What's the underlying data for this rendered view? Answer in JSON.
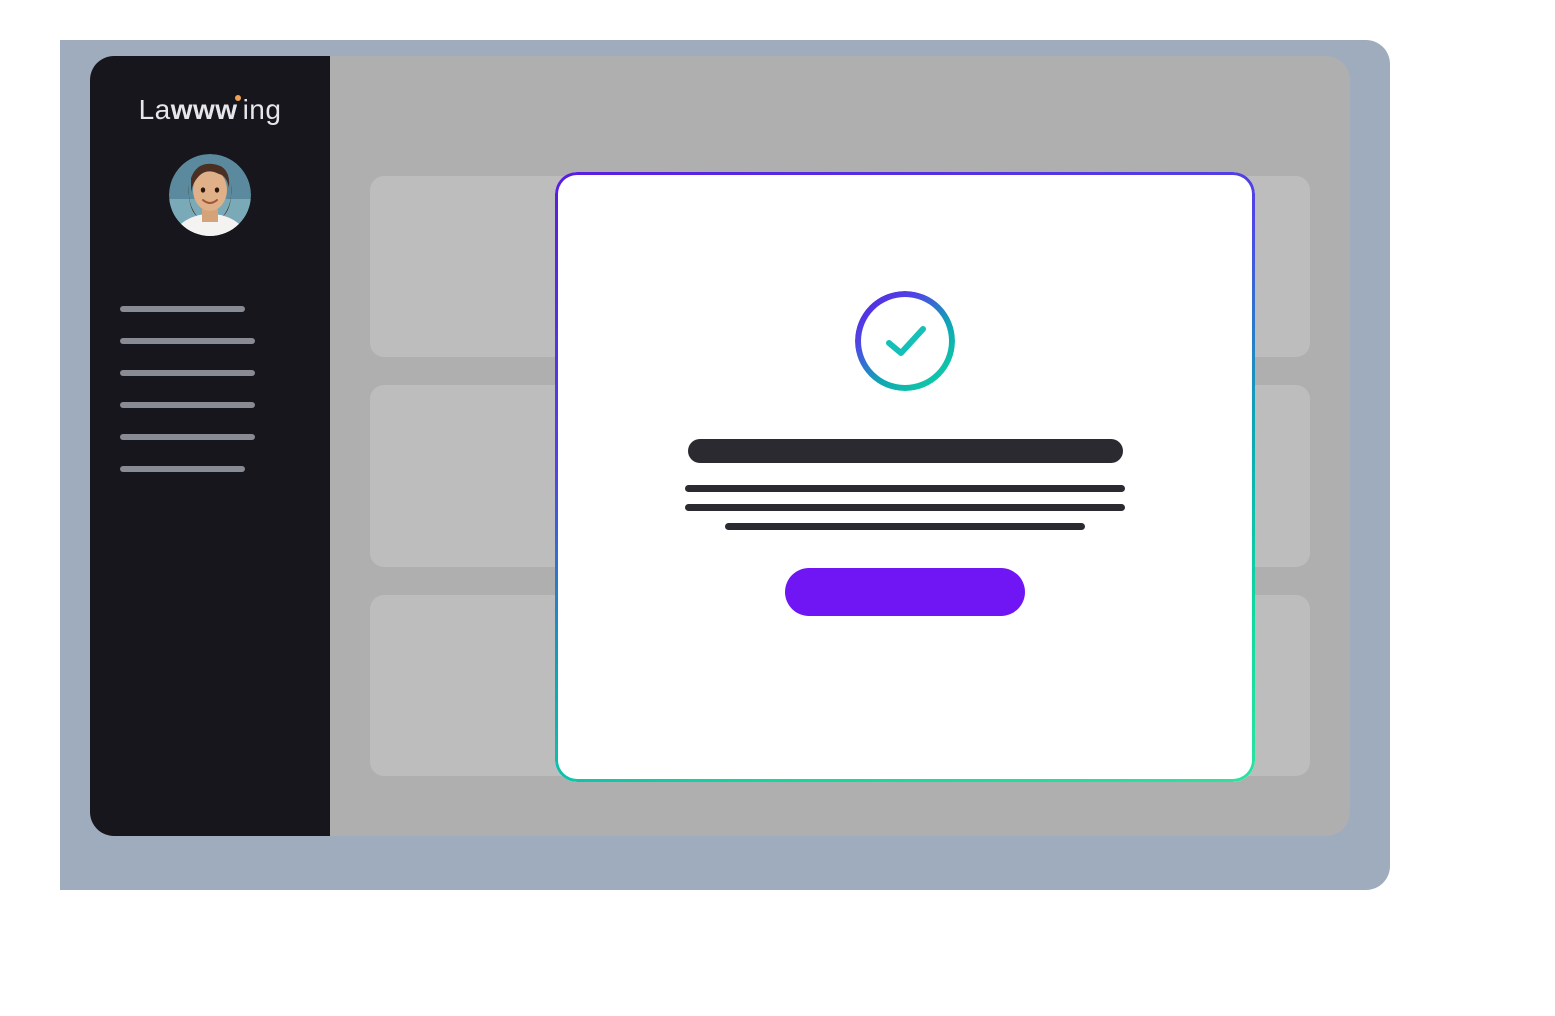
{
  "brand": {
    "part1": "La",
    "part2": "www",
    "part3": "ing"
  },
  "colors": {
    "accent_purple": "#7016f5",
    "gradient_start": "#5a1de0",
    "gradient_end": "#2de3a0",
    "sidebar_bg": "#16161c"
  },
  "sidebar": {
    "nav_count": 6
  },
  "main": {
    "card_count": 9
  },
  "modal": {
    "icon": "checkmark-success",
    "title_placeholder": "",
    "body_lines": 3,
    "button_label": ""
  }
}
